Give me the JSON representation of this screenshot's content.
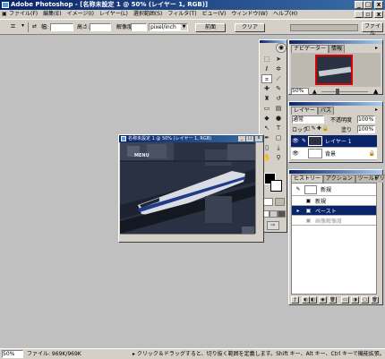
{
  "window": {
    "title": "Adobe Photoshop - [名称未設定 1 @ 50% (レイヤー 1, RGB)]",
    "minimize": "_",
    "maximize": "□",
    "close": "x"
  },
  "menu": [
    "ファイル(F)",
    "編集(E)",
    "イメージ(I)",
    "レイヤー(L)",
    "選択範囲(S)",
    "フィルタ(T)",
    "ビュー(V)",
    "ウィンドウ(W)",
    "ヘルプ(H)"
  ],
  "options": {
    "width_label": "幅:",
    "height_label": "高さ:",
    "resolution_label": "解像度:",
    "unit": "pixel/inch",
    "front_button": "前面",
    "clear_button": "クリア",
    "file_browser_tab": "ファイル"
  },
  "navigator": {
    "tabs": [
      "ナビゲーター",
      "情報"
    ],
    "zoom": "50%"
  },
  "layers": {
    "tabs": [
      "レイヤー",
      "パス"
    ],
    "blend_mode": "通常",
    "opacity_label": "不透明度",
    "opacity_value": "100%",
    "lock_label": "ロック",
    "fill_label": "塗り",
    "fill_value": "100%",
    "items": [
      {
        "name": "レイヤー 1",
        "selected": true
      },
      {
        "name": "背景",
        "selected": false
      }
    ]
  },
  "history": {
    "tabs": [
      "ヒストリー",
      "アクション",
      "ツールプリセット"
    ],
    "snapshot": "新規",
    "items": [
      {
        "name": "新規",
        "selected": false
      },
      {
        "name": "ペースト",
        "selected": true
      },
      {
        "name": "画像解像度",
        "selected": false
      }
    ]
  },
  "document": {
    "title": "名称未設定 1 @ 50% (レイヤー 1, RGB)",
    "canvas_text": "MENU"
  },
  "status": {
    "zoom": "50%",
    "file_info": "ファイル: 969K/969K",
    "hint": "▸ クリック＆ドラッグすると、切り抜く範囲を定義します。Shift キー、Alt キー、Ctrl キーで機能拡張。"
  },
  "colors": {
    "titlebar": "#0a246a",
    "selection": "#0a246a",
    "face": "#d4d0c8",
    "workspace": "#c0c0c0"
  }
}
